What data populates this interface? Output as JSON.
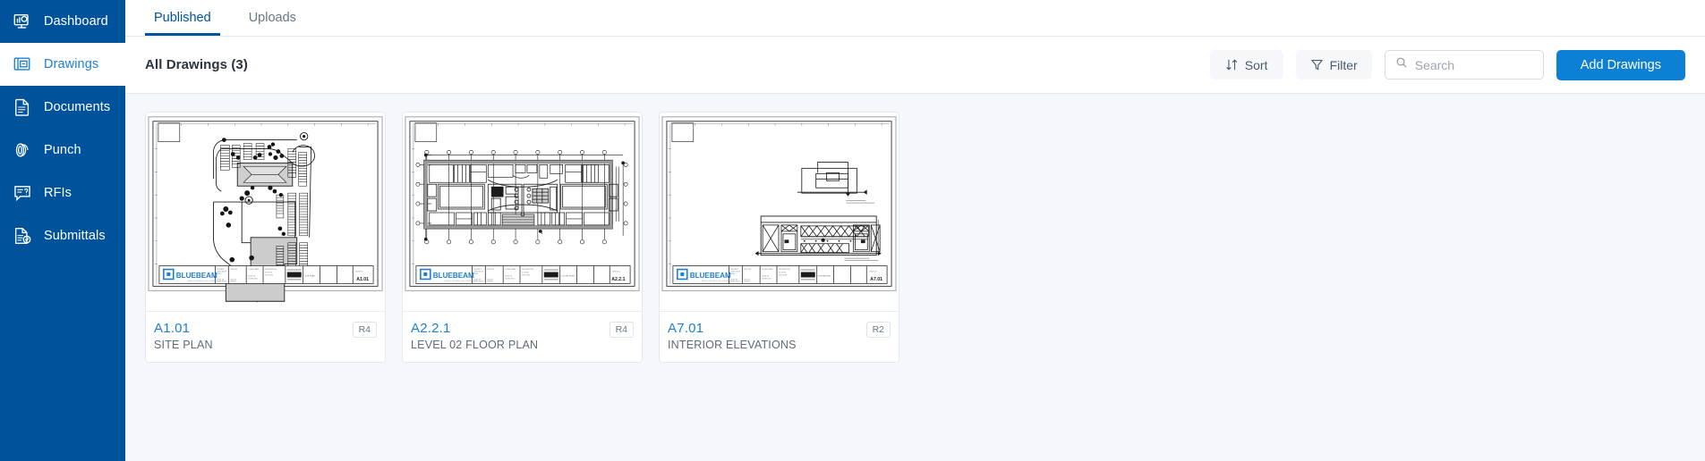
{
  "sidebar": {
    "items": [
      {
        "id": "dashboard",
        "label": "Dashboard",
        "icon": "dashboard-icon",
        "active": false
      },
      {
        "id": "drawings",
        "label": "Drawings",
        "icon": "drawings-icon",
        "active": true
      },
      {
        "id": "documents",
        "label": "Documents",
        "icon": "documents-icon",
        "active": false
      },
      {
        "id": "punch",
        "label": "Punch",
        "icon": "punch-icon",
        "active": false
      },
      {
        "id": "rfis",
        "label": "RFIs",
        "icon": "rfi-icon",
        "active": false
      },
      {
        "id": "submittals",
        "label": "Submittals",
        "icon": "submittals-icon",
        "active": false
      }
    ],
    "background_color": "#00539b",
    "active_text_color": "#1b7fd4"
  },
  "tabs": [
    {
      "id": "published",
      "label": "Published",
      "active": true
    },
    {
      "id": "uploads",
      "label": "Uploads",
      "active": false
    }
  ],
  "toolbar": {
    "title": "All Drawings (3)",
    "sort_label": "Sort",
    "filter_label": "Filter",
    "add_label": "Add Drawings",
    "accent_color": "#0d7fd4"
  },
  "search": {
    "value": "",
    "placeholder": "Search"
  },
  "drawings": [
    {
      "number": "A1.01",
      "description": "SITE PLAN",
      "revision": "R4",
      "thumbnail_type": "site-plan",
      "titleblock_logo": "BLUEBEAM",
      "sheet_label": "A1.01"
    },
    {
      "number": "A2.2.1",
      "description": "LEVEL 02 FLOOR PLAN",
      "revision": "R4",
      "thumbnail_type": "floor-plan",
      "titleblock_logo": "BLUEBEAM",
      "sheet_label": "A2.2.1"
    },
    {
      "number": "A7.01",
      "description": "INTERIOR ELEVATIONS",
      "revision": "R2",
      "thumbnail_type": "interior-elevations",
      "titleblock_logo": "BLUEBEAM",
      "sheet_label": "A7.01"
    }
  ]
}
